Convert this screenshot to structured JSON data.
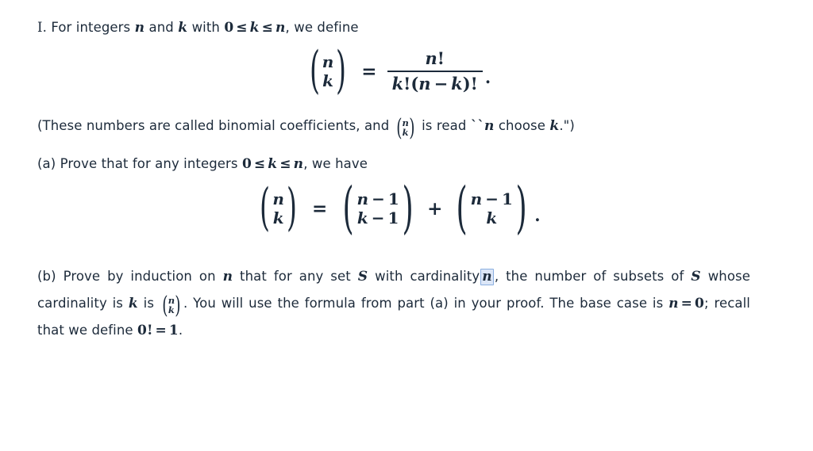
{
  "document": {
    "background_color": "#ffffff",
    "text_color": "#1c2a3a",
    "problem_label": "I.",
    "selection_highlight": {
      "fill_color": "#dce6f7",
      "border_color": "#8aaee0",
      "selected_token": "n"
    }
  },
  "intro": {
    "text_before_math": "For integers",
    "var_n": "n",
    "and_word": "and",
    "var_k": "k",
    "with_word": "with",
    "zero": "0",
    "le1": "≤",
    "k2": "k",
    "le2": "≤",
    "n2": "n",
    "comma_tail": ", we define"
  },
  "equation_definition": {
    "lhs_top": "n",
    "lhs_bottom": "k",
    "relation": "=",
    "numerator": "n!",
    "denominator": "k!(n − k)!",
    "numerator_var": "n",
    "numerator_bang": "!",
    "den_k": "k",
    "den_bang1": "!",
    "den_open": "(",
    "den_n": "n",
    "den_minus": "−",
    "den_k2": "k",
    "den_close": ")",
    "den_bang2": "!",
    "trailing_punctuation": "."
  },
  "note_paragraph": {
    "part1": "(These numbers are called binomial coefficients, and",
    "binom_top": "n",
    "binom_bottom": "k",
    "part2": "is read",
    "open_quote": "``",
    "quoted_n": "n",
    "choose_word": "choose",
    "quoted_k": "k",
    "close_quote": ".\")"
  },
  "part_a": {
    "label": "(a)",
    "text1": "Prove that for any integers",
    "zero": "0",
    "le1": "≤",
    "k": "k",
    "le2": "≤",
    "n": "n",
    "text2": ", we have"
  },
  "equation_pascal": {
    "lhs_top": "n",
    "lhs_bottom": "k",
    "relation": "=",
    "term1_top_n": "n",
    "term1_top_minus": "−",
    "term1_top_one": "1",
    "term1_bottom_k": "k",
    "term1_bottom_minus": "−",
    "term1_bottom_one": "1",
    "plus": "+",
    "term2_top_n": "n",
    "term2_top_minus": "−",
    "term2_top_one": "1",
    "term2_bottom_k": "k",
    "trailing_punctuation": "."
  },
  "part_b": {
    "label": "(b)",
    "text1": "Prove by induction on",
    "var_n1": "n",
    "text2": "that for any set",
    "var_S1": "S",
    "text3": "with cardinality",
    "selected_n": "n",
    "text4": ", the number of subsets of",
    "var_S2": "S",
    "text5": "whose cardinality is",
    "var_k": "k",
    "text6": "is",
    "binom_top": "n",
    "binom_bottom": "k",
    "text7": ". You will use the formula from part (a) in your proof. The base case is",
    "base_n": "n",
    "base_eq": "=",
    "base_zero": "0",
    "text8": "; recall that we define",
    "fact_zero": "0!",
    "fact_eq": "=",
    "fact_one": "1",
    "text9": "."
  }
}
